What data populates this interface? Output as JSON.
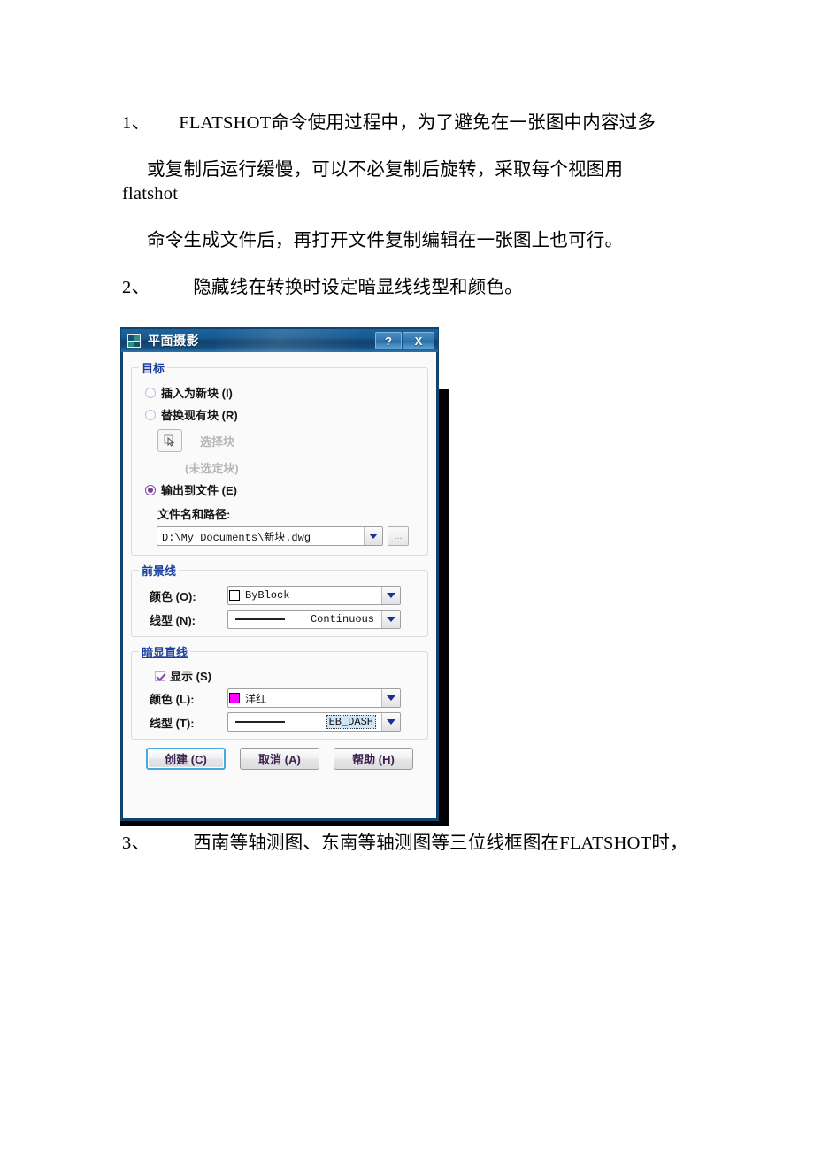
{
  "document": {
    "paragraphs": [
      {
        "number": "1、",
        "line1_mixed": "FLATSHOT命令使用过程中，为了避免在一张图中内容过多",
        "line2": "或复制后运行缓慢，可以不必复制后旋转，采取每个视图用",
        "line3_mono": "flatshot",
        "line4": "命令生成文件后，再打开文件复制编辑在一张图上也可行。"
      },
      {
        "number": "2、",
        "text": "隐藏线在转换时设定暗显线线型和颜色。"
      },
      {
        "number": "3、",
        "text": "西南等轴测图、东南等轴测图等三位线框图在FLATSHOT时，"
      }
    ]
  },
  "dialog": {
    "title": "平面摄影",
    "icon": "autocad-app-icon",
    "titlebar_buttons": [
      {
        "name": "help-button",
        "glyph": "?"
      },
      {
        "name": "close-button",
        "glyph": "X"
      }
    ],
    "destination_group": {
      "legend": "目标",
      "options": [
        {
          "label": "插入为新块 (I)",
          "checked": false
        },
        {
          "label": "替换现有块 (R)",
          "checked": false
        },
        {
          "label": "输出到文件 (E)",
          "checked": true
        }
      ],
      "select_block_label": "选择块",
      "no_block_selected": "(未选定块)",
      "filename_label": "文件名和路径:",
      "filename_value": "D:\\My Documents\\新块.dwg",
      "browse_button": "...",
      "dropdown_arrow": "chevron-down-icon"
    },
    "foreground_group": {
      "legend": "前景线",
      "color_label": "颜色 (O):",
      "color_value": "ByBlock",
      "color_swatch": "#ffffff",
      "linetype_label": "线型 (N):",
      "linetype_value": "Continuous"
    },
    "obscured_group": {
      "legend": "暗显直线",
      "show_label": "显示 (S)",
      "show_checked": true,
      "color_label": "颜色 (L):",
      "color_value": "洋红",
      "color_swatch": "#ff00ff",
      "linetype_label": "线型 (T):",
      "linetype_value": "EB_DASH",
      "linetype_selected": true
    },
    "buttons": [
      {
        "label": "创建 (C)",
        "default": true
      },
      {
        "label": "取消 (A)",
        "default": false
      },
      {
        "label": "帮助 (H)",
        "default": false
      }
    ]
  },
  "colors": {
    "titlebar_blue": "#12436f",
    "group_legend_blue": "#1a3f9e",
    "magenta": "#ff00ff",
    "focus_blue": "#4aa8e0",
    "selection_blue": "#cfe6f7"
  }
}
